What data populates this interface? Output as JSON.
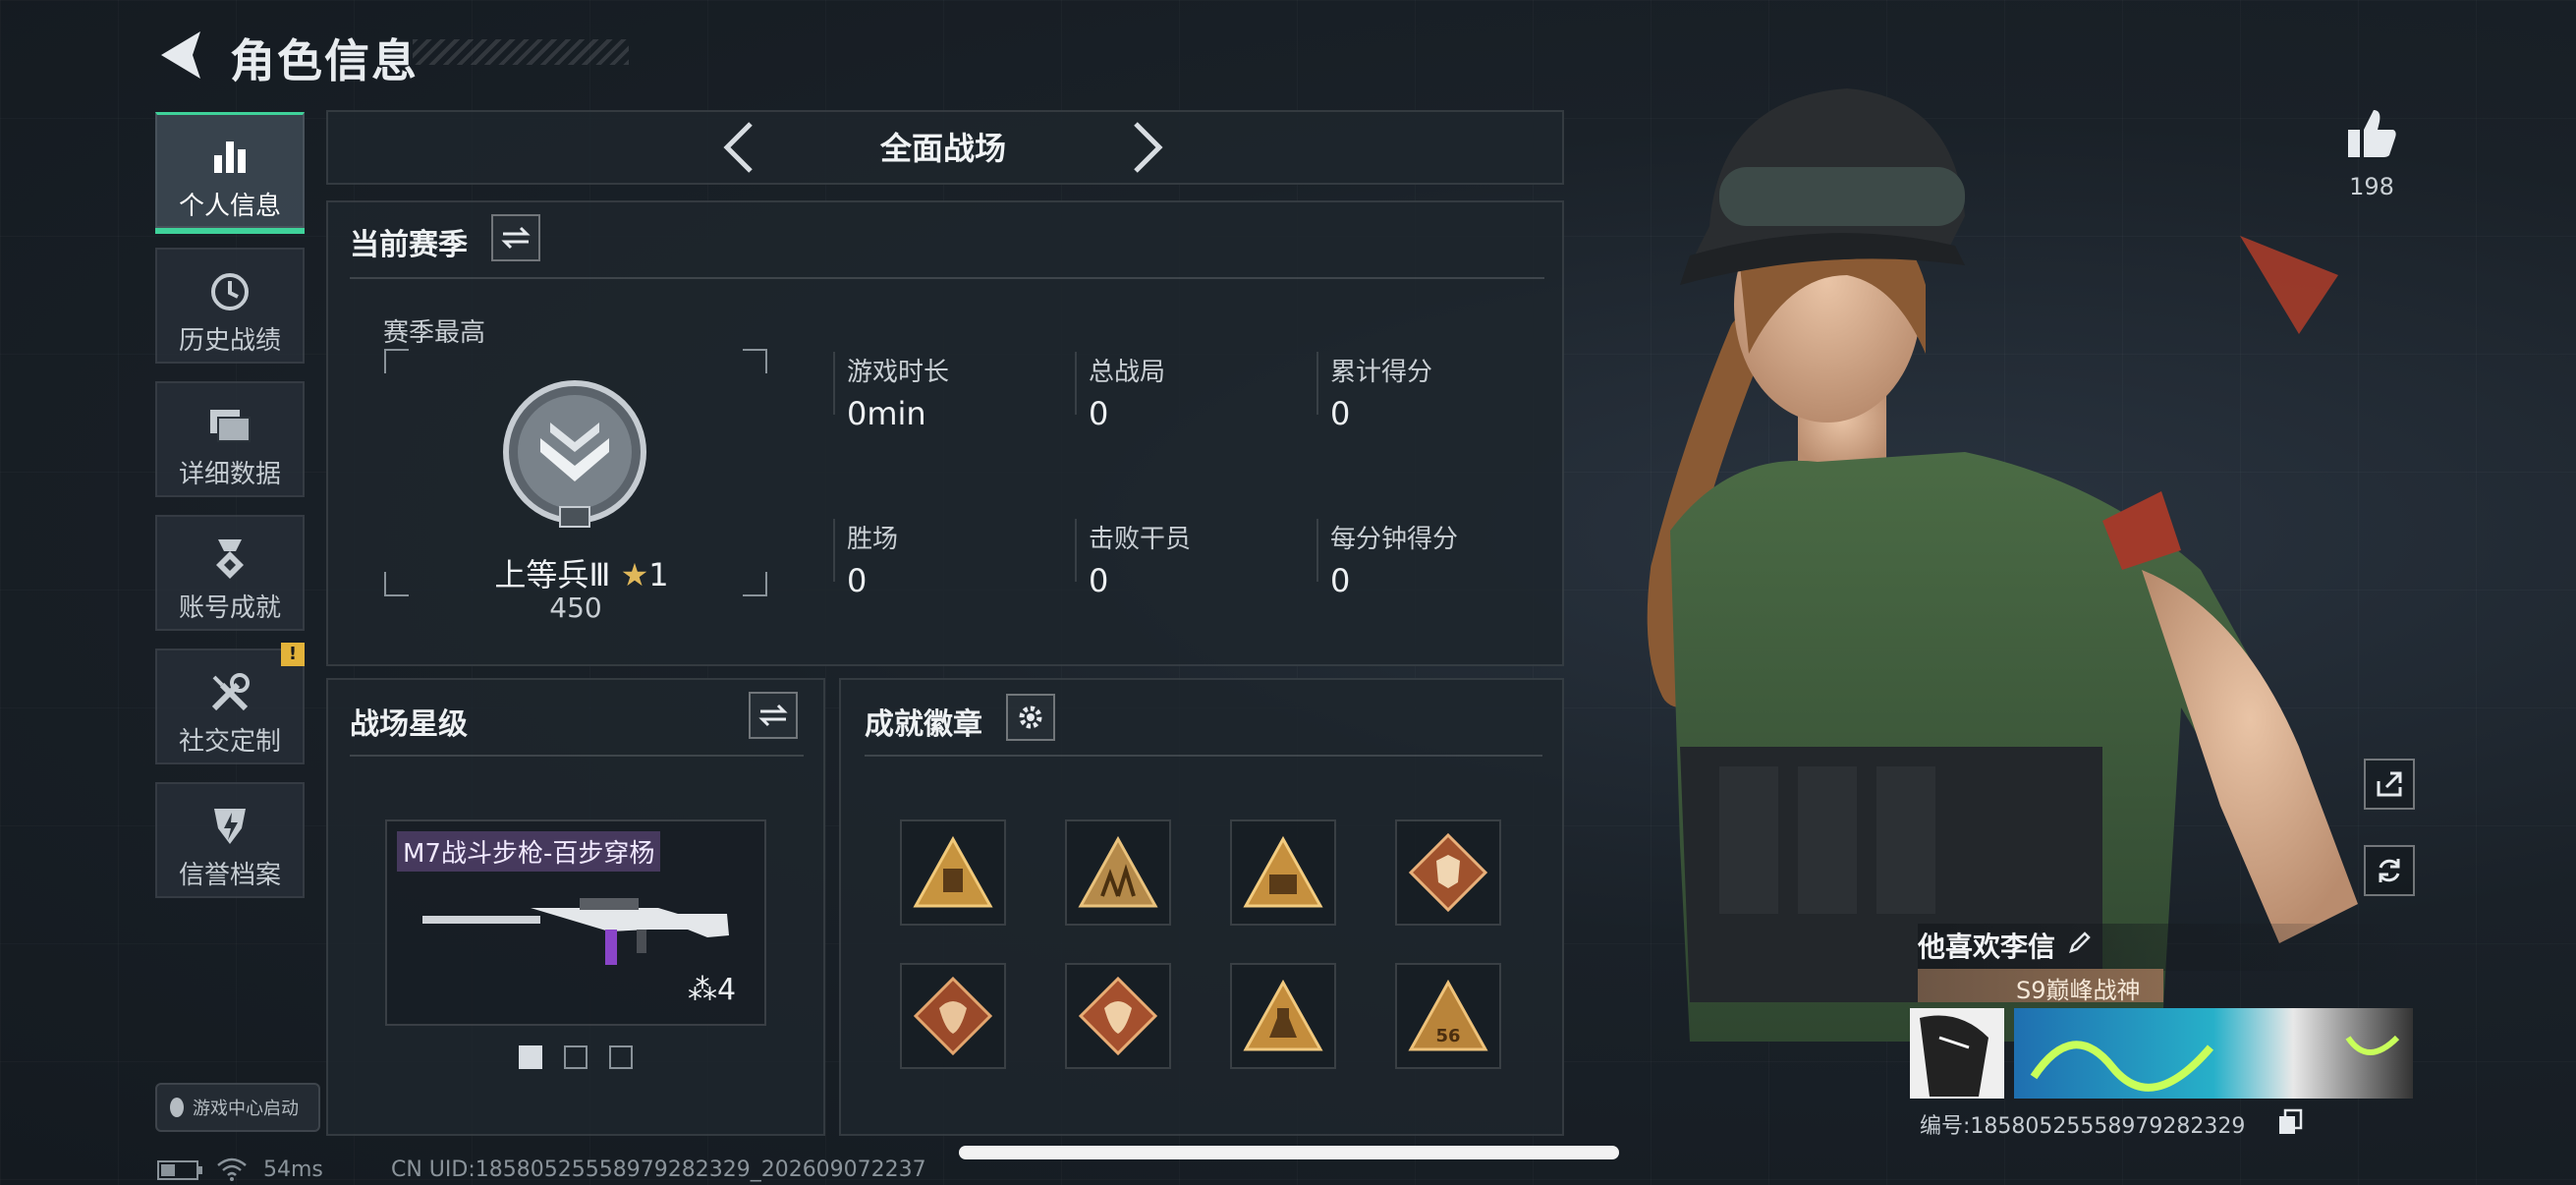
{
  "header": {
    "title": "角色信息"
  },
  "sidebar": {
    "items": [
      {
        "label": "个人信息",
        "icon": "bar-chart-icon",
        "active": true
      },
      {
        "label": "历史战绩",
        "icon": "history-clock-icon"
      },
      {
        "label": "详细数据",
        "icon": "folder-icon"
      },
      {
        "label": "账号成就",
        "icon": "achievement-medal-icon"
      },
      {
        "label": "社交定制",
        "icon": "tools-icon",
        "badge": "!"
      },
      {
        "label": "信誉档案",
        "icon": "credit-shield-icon"
      }
    ],
    "game_center_label": "游戏中心启动"
  },
  "mode_selector": {
    "label": "全面战场"
  },
  "season": {
    "title": "当前赛季",
    "best_label": "赛季最高",
    "rank_name": "上等兵Ⅲ",
    "rank_stars": "1",
    "rank_points": "450",
    "stats": [
      {
        "label": "游戏时长",
        "value": "0min"
      },
      {
        "label": "总战局",
        "value": "0"
      },
      {
        "label": "累计得分",
        "value": "0"
      },
      {
        "label": "胜场",
        "value": "0"
      },
      {
        "label": "击败干员",
        "value": "0"
      },
      {
        "label": "每分钟得分",
        "value": "0"
      }
    ]
  },
  "star_level": {
    "title": "战场星级",
    "weapon_name": "M7战斗步枪-百步穿杨",
    "weapon_level": "4",
    "page_count": 3,
    "current_page": 1
  },
  "achievements": {
    "title": "成就徽章",
    "badge_icons": [
      "supply-badge-icon",
      "squad-badge-icon",
      "cargo-badge-icon",
      "wolf-badge-icon",
      "dragon-badge-icon",
      "dragon-badge-icon-2",
      "flask-badge-icon",
      "medal-56-badge-icon"
    ],
    "badge_56_text": "56"
  },
  "profile": {
    "likes": "198",
    "player_name": "他喜欢李信",
    "title_tag": "S9巅峰战神",
    "player_id": "编号:18580525558979282329"
  },
  "footer": {
    "ping": "54ms",
    "uid": "CN UID:18580525558979282329_202609072237"
  },
  "colors": {
    "accent": "#3fd29a",
    "warning": "#e3b33a",
    "badge_gold": "#d9b56a"
  }
}
